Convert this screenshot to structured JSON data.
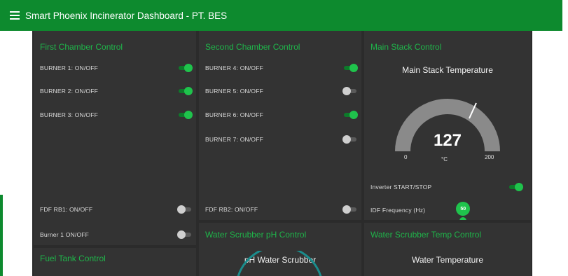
{
  "header": {
    "title": "Smart Phoenix Incinerator Dashboard - PT. BES",
    "menu_icon": "hamburger-menu-icon"
  },
  "colors": {
    "accent": "#1fb54a",
    "header_bg": "#0d8a2e",
    "panel_bg": "#333333",
    "canvas_bg": "#2b2b2b"
  },
  "first_chamber": {
    "title": "First Chamber Control",
    "items": [
      {
        "label": "BURNER 1: ON/OFF",
        "state": "on"
      },
      {
        "label": "BURNER 2: ON/OFF",
        "state": "on"
      },
      {
        "label": "BURNER 3: ON/OFF",
        "state": "on"
      },
      {
        "label": "FDF RB1: ON/OFF",
        "state": "off"
      },
      {
        "label": "Burner 1 ON/OFF",
        "state": "off"
      }
    ]
  },
  "second_chamber": {
    "title": "Second Chamber Control",
    "items": [
      {
        "label": "BURNER 4: ON/OFF",
        "state": "on"
      },
      {
        "label": "BURNER 5: ON/OFF",
        "state": "off"
      },
      {
        "label": "BURNER 6: ON/OFF",
        "state": "on"
      },
      {
        "label": "BURNER 7: ON/OFF",
        "state": "off"
      },
      {
        "label": "FDF RB2: ON/OFF",
        "state": "off"
      }
    ]
  },
  "main_stack": {
    "title": "Main Stack Control",
    "gauge_title": "Main Stack Temperature",
    "value": "127",
    "unit": "°C",
    "min": "0",
    "max": "200",
    "inverter_label": "Inverter START/STOP",
    "inverter_state": "on",
    "idf_label": "IDF Frequency (Hz)",
    "idf_value": "50",
    "idf_fraction": 0.35
  },
  "fuel_tank": {
    "title": "Fuel Tank Control"
  },
  "water_ph": {
    "title": "Water Scrubber pH Control",
    "gauge_title": "pH Water Scrubber"
  },
  "water_temp": {
    "title": "Water Scrubber Temp Control",
    "gauge_title": "Water Temperature"
  }
}
